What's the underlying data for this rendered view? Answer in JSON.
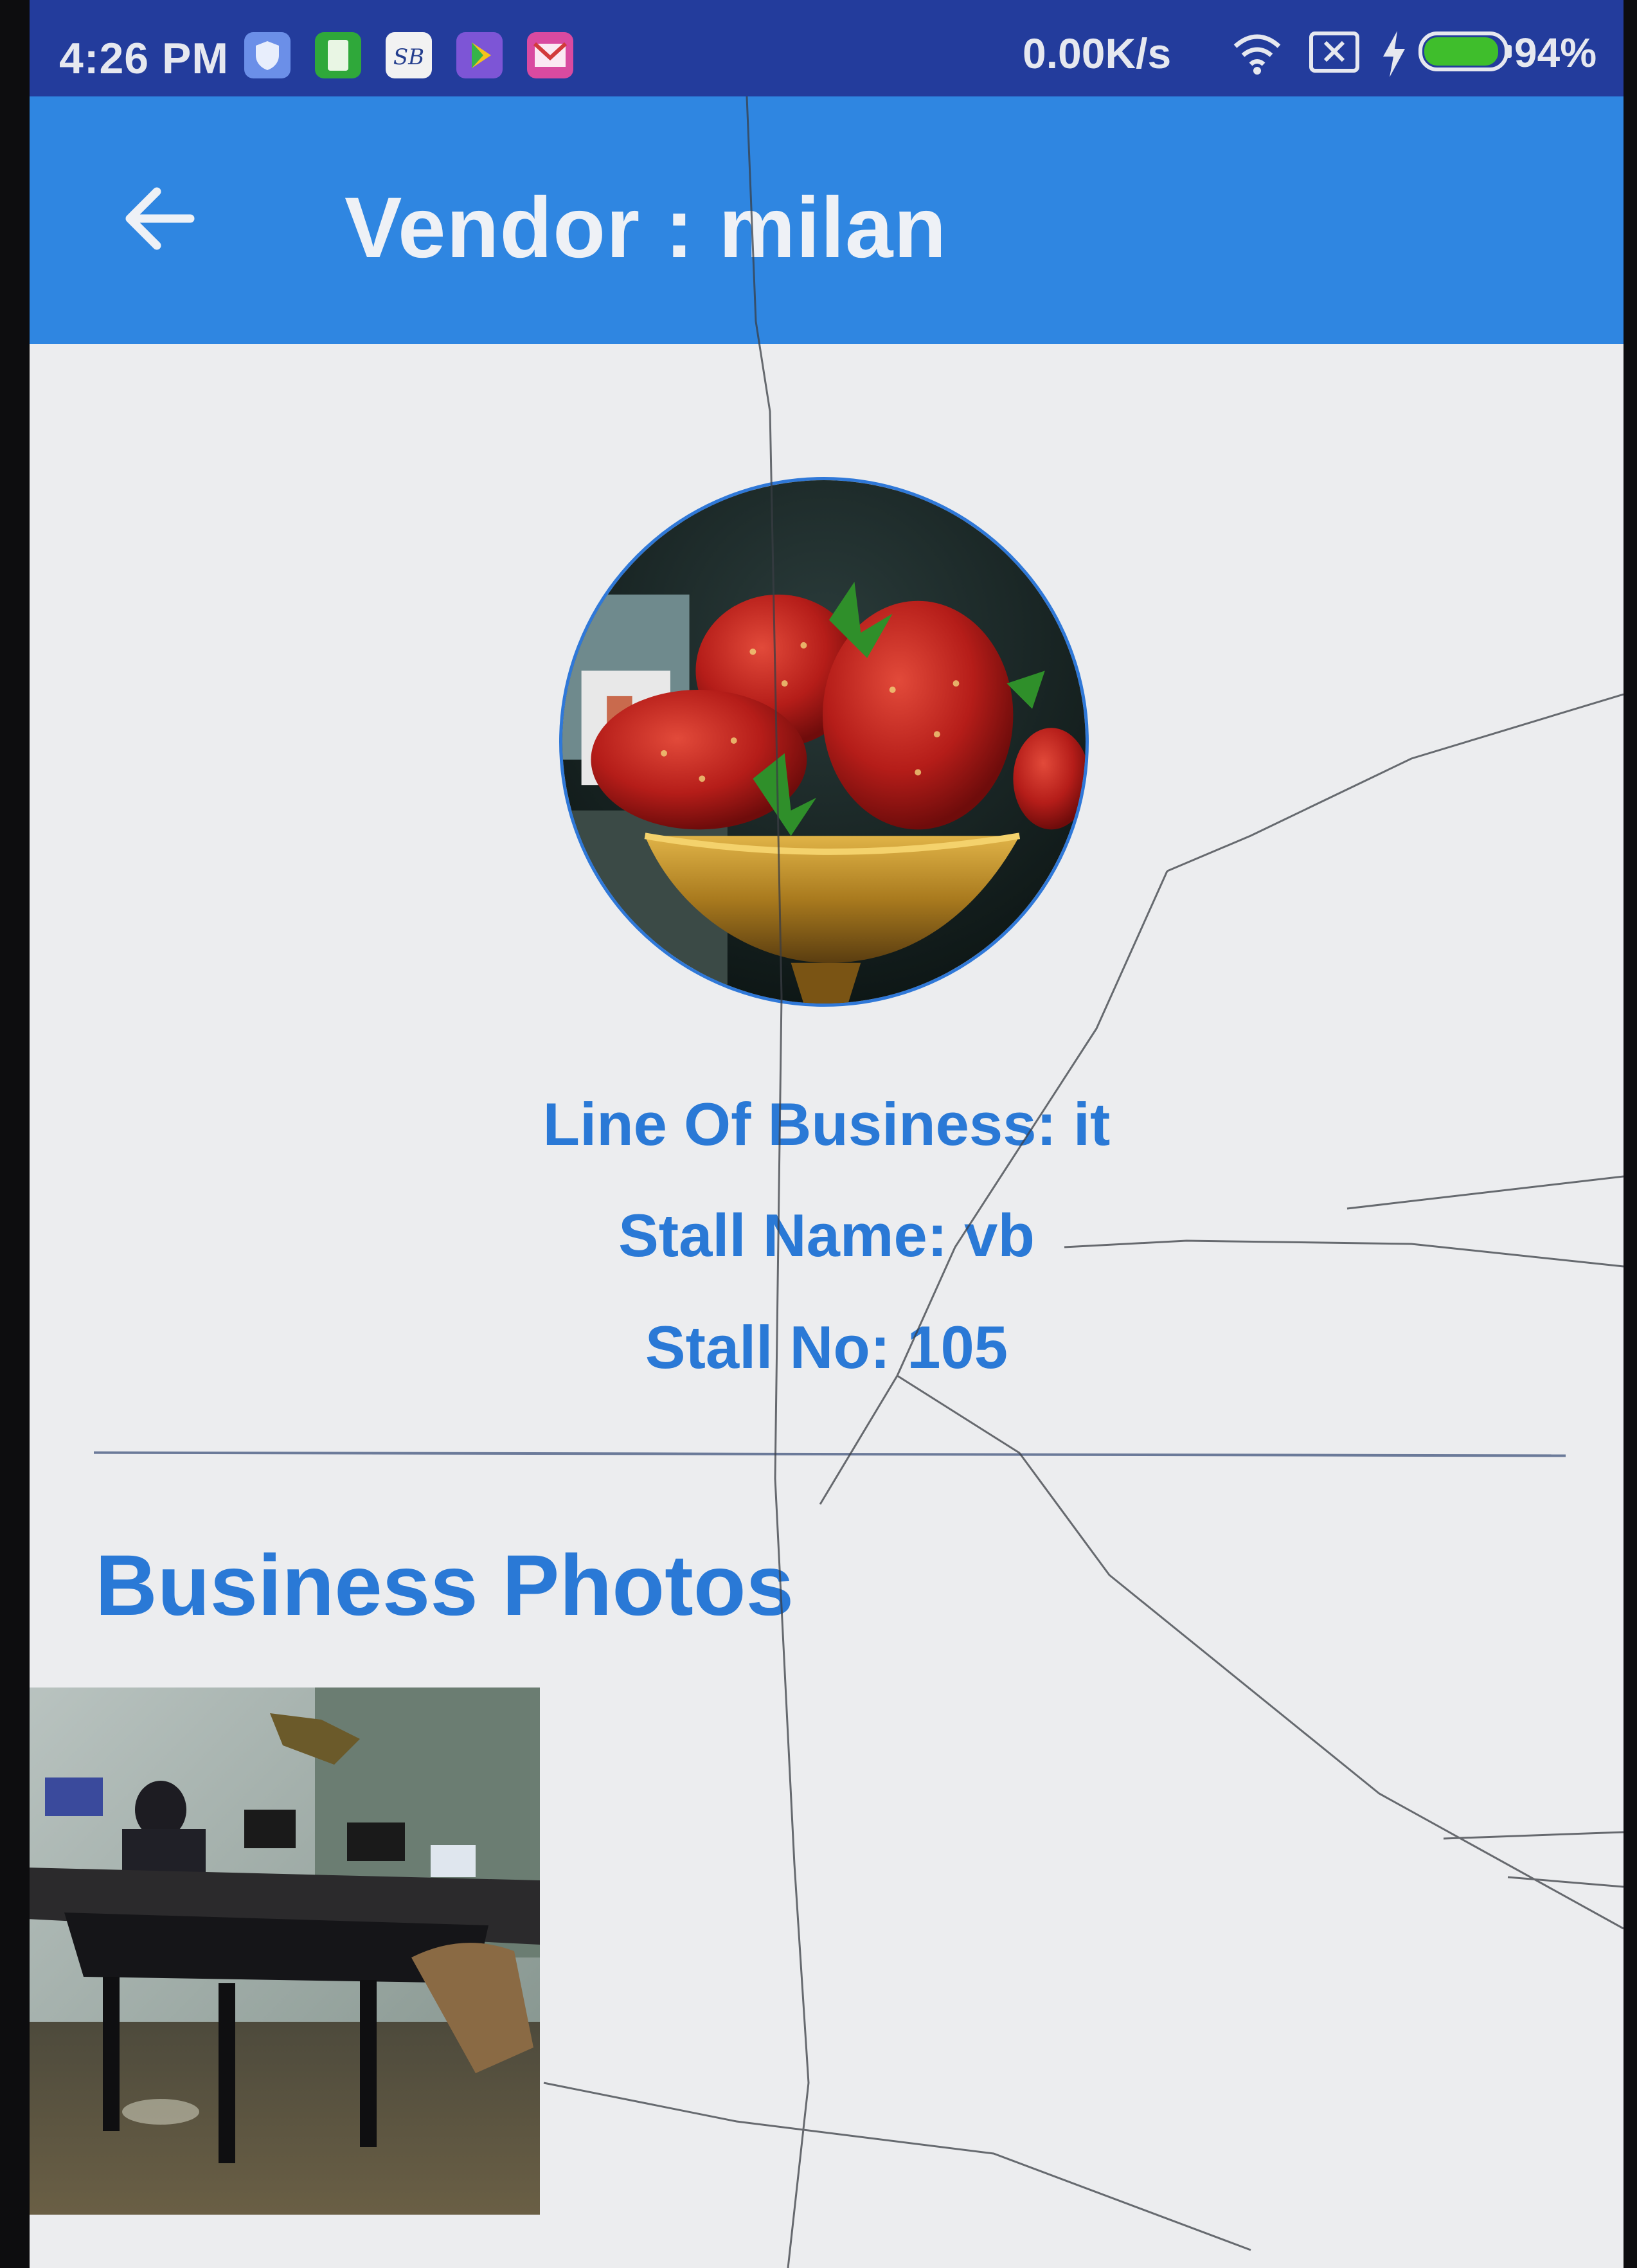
{
  "status_bar": {
    "time": "4:26 PM",
    "app_icons": [
      "shield-app-icon",
      "notes-app-icon",
      "sb-app-icon",
      "play-store-icon",
      "gmail-icon"
    ],
    "network_speed": "0.00K/s",
    "icons": [
      "wifi-icon",
      "no-sim-icon",
      "charging-icon",
      "battery-icon"
    ],
    "battery_percent": "94%",
    "battery_level": 0.94
  },
  "toolbar": {
    "back_icon": "arrow-left-icon",
    "title": "Vendor : milan"
  },
  "profile": {
    "photo": "strawberries-in-bowl-photo",
    "line_of_business": "Line Of Business: it",
    "stall_name": "Stall Name: vb",
    "stall_no": "Stall No: 105"
  },
  "business_photos": {
    "title": "Business Photos",
    "photos": [
      "office-room-photo"
    ]
  },
  "colors": {
    "status_bar": "#233c9c",
    "toolbar": "#2f86e1",
    "accent_text": "#2a79d6",
    "background": "#ecedef"
  }
}
